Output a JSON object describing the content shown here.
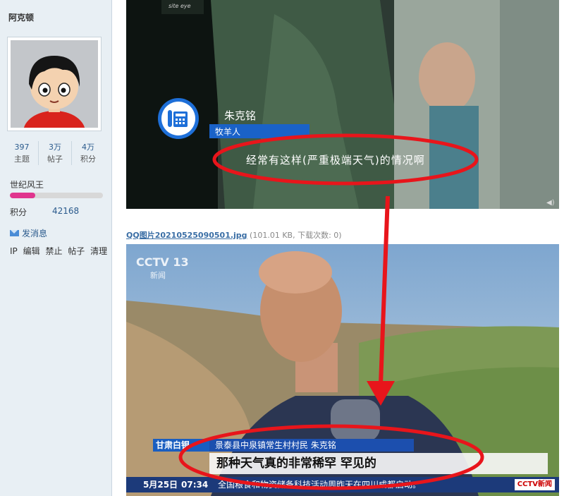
{
  "sidebar": {
    "username": "阿克顿",
    "stats": [
      {
        "value": "397",
        "label": "主题"
      },
      {
        "value": "3万",
        "label": "帖子"
      },
      {
        "value": "4万",
        "label": "积分"
      }
    ],
    "rank_title": "世纪风王",
    "rank_progress": 0.27,
    "points_label": "积分",
    "points_value": "42168",
    "send_message": "发消息",
    "tools": [
      "IP",
      "编辑",
      "禁止",
      "帖子",
      "清理"
    ]
  },
  "image1": {
    "site_eye": "site eye",
    "name": "朱克铭",
    "role": "牧羊人",
    "subtitle": "经常有这样(严重极端天气)的情况啊"
  },
  "attachment": {
    "filename": "QQ图片20210525090501.jpg",
    "meta": " (101.01 KB, 下载次数: 0)"
  },
  "image2": {
    "channel_logo": "CCTV 13",
    "channel_sub": "新闻",
    "location_tag": "甘肃白银",
    "name_line": "景泰县中泉镇常生村村民 朱克铭",
    "quote": "那种天气真的非常稀罕 罕见的",
    "date": "5月25日",
    "time": "07:34",
    "ticker": "全国粮食和物资储备科技活动周昨天在四川成都启动。",
    "ticker_logo": "CCTV新闻"
  },
  "colors": {
    "annotation_red": "#e8151b",
    "sidebar_bg": "#e8eff4",
    "rank_bar": "#e0358e",
    "link_blue": "#3a6ea5"
  }
}
